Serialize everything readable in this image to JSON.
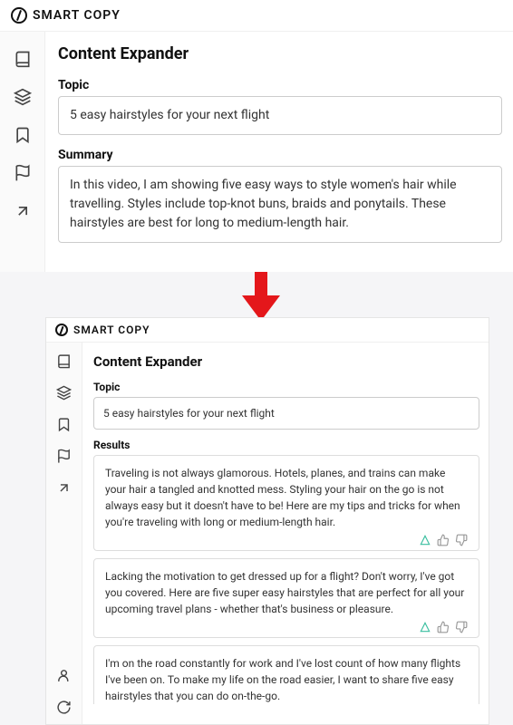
{
  "app": {
    "name": "SMART COPY"
  },
  "top": {
    "page_title": "Content Expander",
    "topic_label": "Topic",
    "topic_value": "5 easy hairstyles for your next flight",
    "summary_label": "Summary",
    "summary_value": "In this video, I am showing five easy ways to style women's hair while travelling. Styles include top-knot buns, braids and ponytails. These hairstyles are best for long to medium-length hair."
  },
  "bottom": {
    "page_title": "Content Expander",
    "topic_label": "Topic",
    "topic_value": "5 easy hairstyles for your next flight",
    "results_label": "Results",
    "results": [
      "Traveling is not always glamorous. Hotels, planes, and trains can make your hair a tangled and knotted mess. Styling your hair on the go is not always easy but it doesn't have to be! Here are my tips and tricks for when you're traveling with long or medium-length hair.",
      "Lacking the motivation to get dressed up for a flight? Don't worry, I've got you covered. Here are five super easy hairstyles that are perfect for all your upcoming travel plans - whether that's business or pleasure.",
      "I'm on the road constantly for work and I've lost count of how many flights I've been on. To make my life on the road easier, I want to share five easy hairstyles that you can do on-the-go."
    ]
  }
}
